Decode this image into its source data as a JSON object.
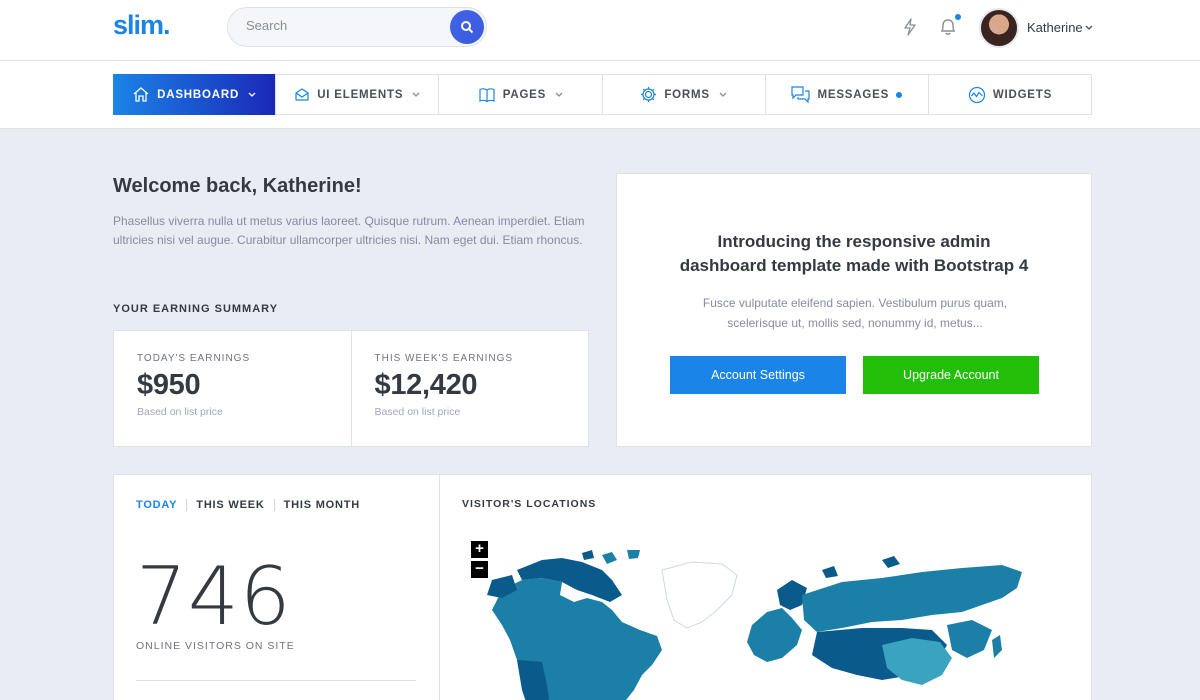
{
  "header": {
    "logo": "slim.",
    "search_placeholder": "Search",
    "user_name": "Katherine"
  },
  "nav": {
    "items": [
      {
        "label": "DASHBOARD",
        "icon": "home-icon",
        "active": true,
        "has_chevron": true
      },
      {
        "label": "UI ELEMENTS",
        "icon": "inbox-icon",
        "has_chevron": true
      },
      {
        "label": "PAGES",
        "icon": "book-icon",
        "has_chevron": true
      },
      {
        "label": "FORMS",
        "icon": "gear-icon",
        "has_chevron": true
      },
      {
        "label": "MESSAGES",
        "icon": "chat-icon",
        "has_dot": true
      },
      {
        "label": "WIDGETS",
        "icon": "pulse-icon"
      }
    ]
  },
  "welcome": {
    "title": "Welcome back, Katherine!",
    "text": "Phasellus viverra nulla ut metus varius laoreet. Quisque rutrum. Aenean imperdiet. Etiam ultricies nisi vel augue. Curabitur ullamcorper ultricies nisi. Nam eget dui. Etiam rhoncus."
  },
  "earnings": {
    "section_label": "YOUR EARNING SUMMARY",
    "today": {
      "label": "TODAY'S EARNINGS",
      "value": "$950",
      "note": "Based on list price"
    },
    "week": {
      "label": "THIS WEEK'S EARNINGS",
      "value": "$12,420",
      "note": "Based on list price"
    }
  },
  "promo": {
    "title_line1": "Introducing the responsive admin",
    "title_line2": "dashboard template made with Bootstrap 4",
    "text_line1": "Fusce vulputate eleifend sapien. Vestibulum purus quam,",
    "text_line2": "scelerisque ut, mollis sed, nonummy id, metus...",
    "btn_settings": "Account Settings",
    "btn_upgrade": "Upgrade Account"
  },
  "stats": {
    "tabs": [
      "TODAY",
      "THIS WEEK",
      "THIS MONTH"
    ],
    "online_count": "746",
    "online_label": "ONLINE VISITORS ON SITE"
  },
  "map": {
    "title": "VISITOR'S LOCATIONS",
    "zoom_in": "+",
    "zoom_out": "−",
    "colors": {
      "dark": "#0a5a8c",
      "mid": "#1b7fa8",
      "light": "#3aa3c0",
      "none": "#ffffff"
    }
  },
  "colors": {
    "primary": "#1b84e7",
    "success": "#23bf08",
    "background": "#e9ecf3"
  }
}
